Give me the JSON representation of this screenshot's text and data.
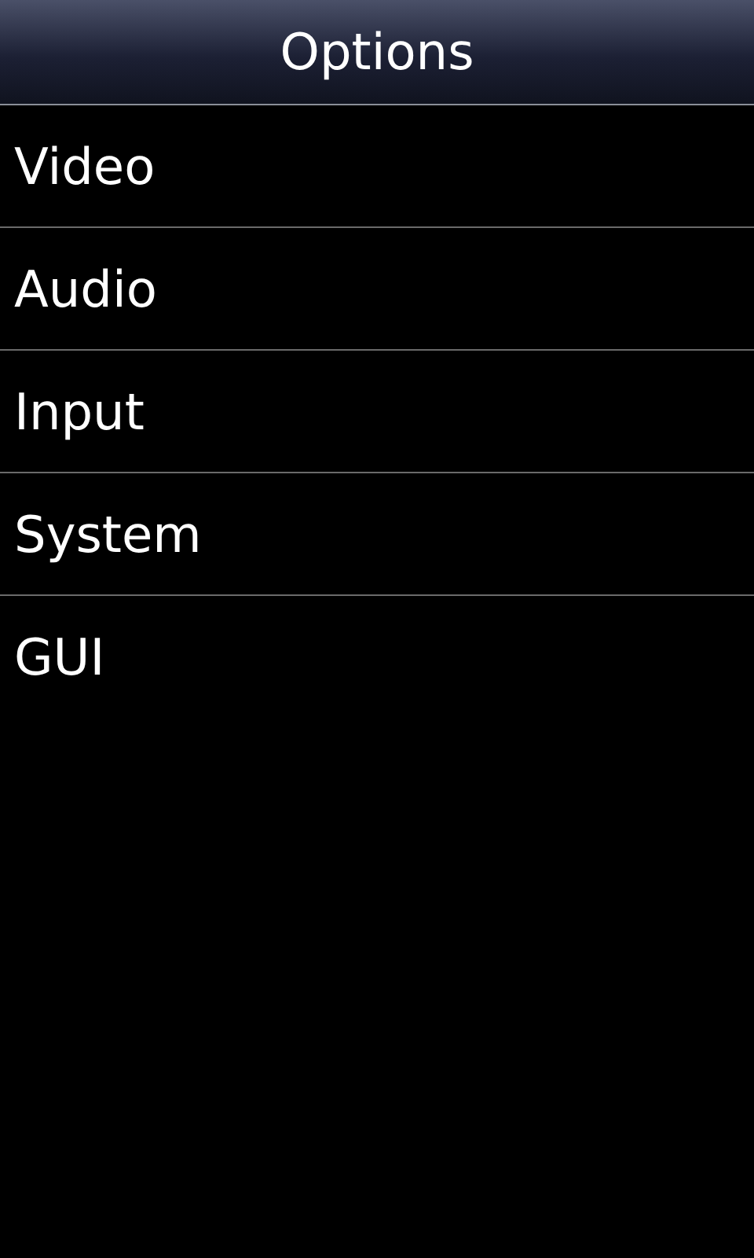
{
  "header": {
    "title": "Options"
  },
  "items": [
    {
      "label": "Video"
    },
    {
      "label": "Audio"
    },
    {
      "label": "Input"
    },
    {
      "label": "System"
    },
    {
      "label": "GUI"
    }
  ]
}
